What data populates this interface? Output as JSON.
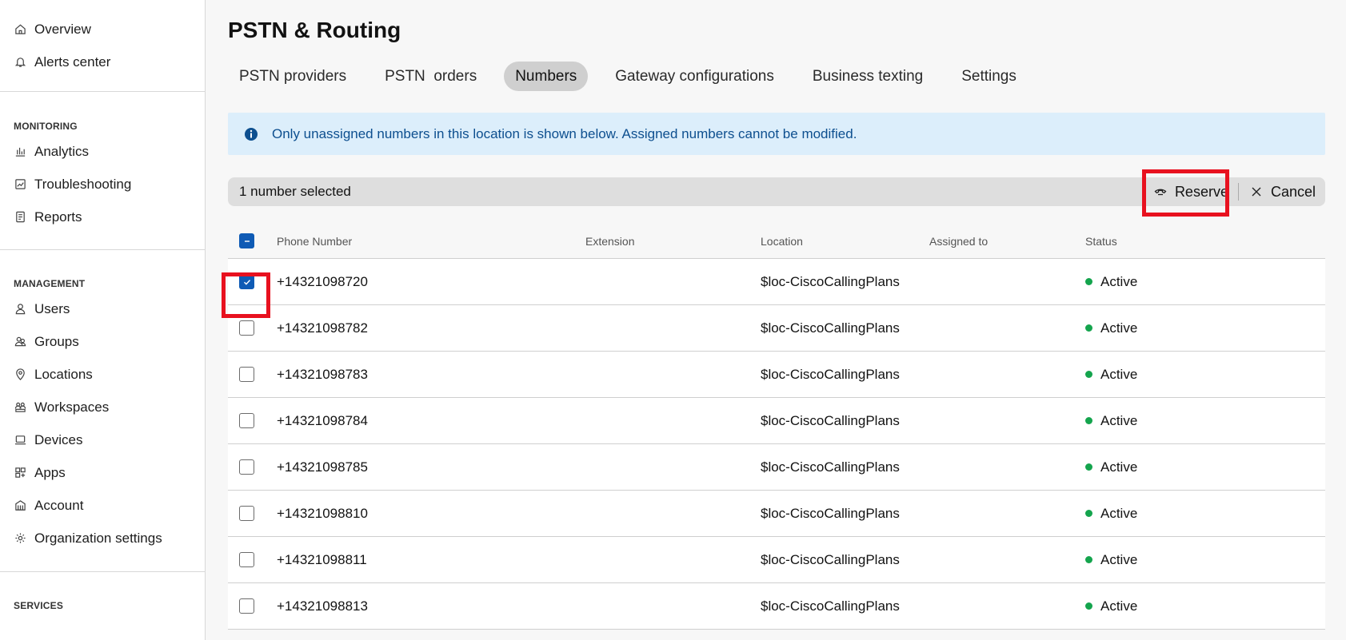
{
  "sidebar": {
    "top_items": [
      {
        "label": "Overview",
        "icon": "home-icon"
      },
      {
        "label": "Alerts center",
        "icon": "bell-icon"
      }
    ],
    "sections": [
      {
        "header": "MONITORING",
        "items": [
          {
            "label": "Analytics",
            "icon": "analytics-icon"
          },
          {
            "label": "Troubleshooting",
            "icon": "troubleshooting-icon"
          },
          {
            "label": "Reports",
            "icon": "reports-icon"
          }
        ]
      },
      {
        "header": "MANAGEMENT",
        "items": [
          {
            "label": "Users",
            "icon": "user-icon"
          },
          {
            "label": "Groups",
            "icon": "groups-icon"
          },
          {
            "label": "Locations",
            "icon": "location-pin-icon"
          },
          {
            "label": "Workspaces",
            "icon": "workspaces-icon"
          },
          {
            "label": "Devices",
            "icon": "devices-icon"
          },
          {
            "label": "Apps",
            "icon": "apps-icon"
          },
          {
            "label": "Account",
            "icon": "account-icon"
          },
          {
            "label": "Organization settings",
            "icon": "gear-icon"
          }
        ]
      },
      {
        "header": "SERVICES",
        "items": []
      }
    ]
  },
  "main": {
    "title": "PSTN & Routing",
    "tabs": [
      {
        "label": "PSTN providers",
        "active": false
      },
      {
        "label": "PSTN  orders",
        "active": false
      },
      {
        "label": "Numbers",
        "active": true
      },
      {
        "label": "Gateway configurations",
        "active": false
      },
      {
        "label": "Business texting",
        "active": false
      },
      {
        "label": "Settings",
        "active": false
      }
    ],
    "info_banner": "Only unassigned numbers in this location is shown below. Assigned numbers cannot be modified.",
    "selection_bar": {
      "count_text": "1 number selected",
      "reserve_label": "Reserve",
      "cancel_label": "Cancel"
    },
    "table": {
      "headers": {
        "phone": "Phone Number",
        "extension": "Extension",
        "location": "Location",
        "assigned": "Assigned to",
        "status": "Status"
      },
      "rows": [
        {
          "phone": "+14321098720",
          "extension": "",
          "location": "$loc-CiscoCallingPlans",
          "assigned": "",
          "status": "Active",
          "checked": true
        },
        {
          "phone": "+14321098782",
          "extension": "",
          "location": "$loc-CiscoCallingPlans",
          "assigned": "",
          "status": "Active",
          "checked": false
        },
        {
          "phone": "+14321098783",
          "extension": "",
          "location": "$loc-CiscoCallingPlans",
          "assigned": "",
          "status": "Active",
          "checked": false
        },
        {
          "phone": "+14321098784",
          "extension": "",
          "location": "$loc-CiscoCallingPlans",
          "assigned": "",
          "status": "Active",
          "checked": false
        },
        {
          "phone": "+14321098785",
          "extension": "",
          "location": "$loc-CiscoCallingPlans",
          "assigned": "",
          "status": "Active",
          "checked": false
        },
        {
          "phone": "+14321098810",
          "extension": "",
          "location": "$loc-CiscoCallingPlans",
          "assigned": "",
          "status": "Active",
          "checked": false
        },
        {
          "phone": "+14321098811",
          "extension": "",
          "location": "$loc-CiscoCallingPlans",
          "assigned": "",
          "status": "Active",
          "checked": false
        },
        {
          "phone": "+14321098813",
          "extension": "",
          "location": "$loc-CiscoCallingPlans",
          "assigned": "",
          "status": "Active",
          "checked": false
        }
      ]
    }
  },
  "colors": {
    "accent": "#0f5bb5",
    "highlight": "#e8111f",
    "status_active": "#14a44d",
    "banner_bg": "#dceefb",
    "banner_text": "#0d4f8f"
  }
}
